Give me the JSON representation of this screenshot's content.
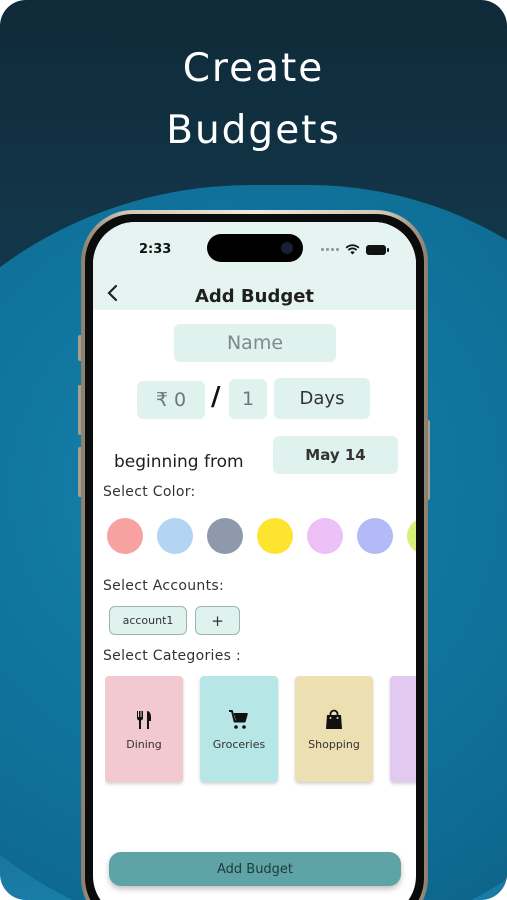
{
  "promo": {
    "headline_line1": "Create",
    "headline_line2": "Budgets"
  },
  "status_bar": {
    "time": "2:33"
  },
  "header": {
    "back_icon": "chevron-left-icon",
    "title": "Add Budget"
  },
  "form": {
    "name_placeholder": "Name",
    "amount": "₹ 0",
    "separator": "/",
    "period_count": "1",
    "period_unit": "Days",
    "beginning_label": "beginning from",
    "start_date": "May 14"
  },
  "colors_section": {
    "label": "Select Color:",
    "swatches": [
      "#f7a1a1",
      "#b3d4f2",
      "#8e9aab",
      "#fde52f",
      "#edc1f5",
      "#b4b9f7",
      "#d8ef7a"
    ]
  },
  "accounts_section": {
    "label": "Select Accounts:",
    "accounts": [
      "account1"
    ],
    "add_label": "+"
  },
  "categories_section": {
    "label": "Select Categories :",
    "categories": [
      {
        "label": "Dining",
        "icon": "fork-knife-icon",
        "color": "#f2c9d0"
      },
      {
        "label": "Groceries",
        "icon": "cart-icon",
        "color": "#b7e6e6"
      },
      {
        "label": "Shopping",
        "icon": "shopping-bag-icon",
        "color": "#ecdfb2"
      },
      {
        "label": "",
        "icon": "",
        "color": "#e2c9f0"
      }
    ]
  },
  "submit": {
    "label": "Add Budget"
  }
}
